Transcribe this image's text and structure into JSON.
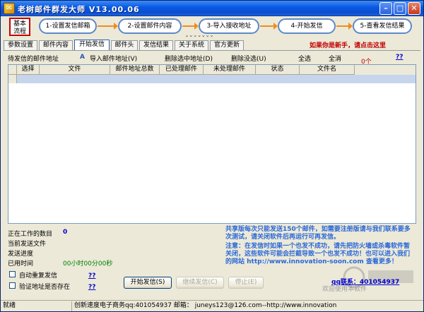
{
  "window": {
    "title": "老树邮件群发大师 V13.00.06",
    "icon": "app-icon"
  },
  "flow": {
    "badge": "基本流程",
    "steps": [
      "1-设置发信邮箱",
      "2-设置邮件内容",
      "3-导入接收地址",
      "4-开始发信",
      "5-查看发信结果"
    ],
    "collapse_glyph": "⌄⌄⌄⌄⌄⌄⌄"
  },
  "tabs": [
    "参数设置",
    "邮件内容",
    "开始发信",
    "邮件头",
    "发信结果",
    "关于系统",
    "官方更新"
  ],
  "new_user_link": "如果你是新手，请点击这里",
  "toolbar": {
    "pending_label": "待发信的邮件地址",
    "import": "导入邮件地址(V)",
    "delete_selected": "删除选中地址(D)",
    "delete_empty": "删除没选(U)",
    "select_all": "全选",
    "deselect": "全消",
    "count": "0个",
    "help": "??"
  },
  "table": {
    "columns": [
      "选择",
      "文件",
      "邮件地址总数",
      "已处理邮件",
      "未处理邮件",
      "状态",
      "文件名"
    ]
  },
  "status": {
    "working_label": "正在工作的数目",
    "working_value": "0",
    "current_file_label": "当前发送文件",
    "progress_label": "发送进度",
    "elapsed_label": "已用时间",
    "elapsed_value": "00小时00分00秒",
    "auto_resend": "自动重复发信",
    "verify_address": "验证地址是否存在",
    "help": "??"
  },
  "notice": {
    "line1": "共享版每次只能发送150个邮件，如需要注册版请与我们联系要多次测试，请关闭软件后再运行可再发信。",
    "line2": "注意：在发信时如果一个也发不成功，请先把防火墙或杀毒软件暂关闭，这些软件可能会拦截导致一个也发不成功！也可以进入我们的网站 http://www.innovation-soon.com 查看更多！",
    "qq": "qq联系：401054937",
    "faint": "欢迎使用本软件"
  },
  "buttons": {
    "start": "开始发信(S)",
    "pause": "继续发信(C)",
    "stop": "停止(E)"
  },
  "statusbar": {
    "state": "就绪",
    "company": "创新速度电子商务qq:401054937 邮箱： juneys123@126.com--http://www.innovation"
  },
  "colors": {
    "title_blue": "#0a58e3",
    "link_red": "#c00000",
    "notice_blue": "#2a68d8",
    "selection": "#c6d5ec"
  }
}
